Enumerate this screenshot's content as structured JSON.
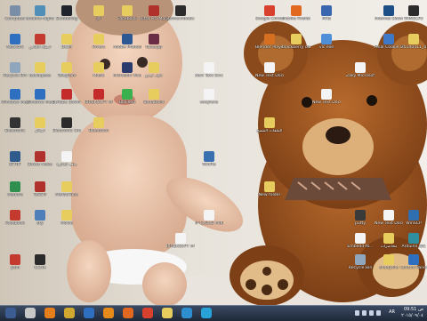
{
  "desktop": {
    "icons": [
      {
        "label": "Computer",
        "color": "#7a8ea8"
      },
      {
        "label": "arduino-nightly",
        "color": "#4f8fb8"
      },
      {
        "label": "Scrobbling",
        "color": "#20242c"
      },
      {
        "label": "jsi",
        "color": "#e6cd5e"
      },
      {
        "label": "Facebook",
        "color": "#e6cd5e"
      },
      {
        "label": "Ultra Pro Morph",
        "color": "#b0302c"
      },
      {
        "label": "itsmechdeels",
        "color": "#2c2c2c"
      },
      {
        "label": "Google Chrome",
        "color": "#d9412f"
      },
      {
        "label": "Mozilla Firefox",
        "color": "#e3681f"
      },
      {
        "label": "MHz",
        "color": "#3a66b0"
      },
      {
        "label": "Internet Download",
        "color": "#1c4f86"
      },
      {
        "label": "WINSCP5",
        "color": "#2c2c2c"
      },
      {
        "label": "Network",
        "color": "#2e6fc0"
      },
      {
        "label": "اسئلة الخاص",
        "color": "#c43a2f"
      },
      {
        "label": "DCIM",
        "color": "#e6cd5e"
      },
      {
        "label": "Rivers",
        "color": "#e6cd5e"
      },
      {
        "label": "Adobe Photoshop CS",
        "color": "#2b5893"
      },
      {
        "label": "faceapp",
        "color": "#6b2c45"
      },
      {
        "label": "Blender Player",
        "color": "#d66f1f"
      },
      {
        "label": "blackberry classic",
        "color": "#e6cd5e"
      },
      {
        "label": "vlc.exe",
        "color": "#4f8fd8"
      },
      {
        "label": "Final Cookie Player",
        "color": "#3e79c8"
      },
      {
        "label": "20140411_0",
        "color": "#e6cd5e"
      },
      {
        "label": "Recycle Bin",
        "color": "#8fa6bd"
      },
      {
        "label": "backupsse",
        "color": "#e6cd5e"
      },
      {
        "label": "Telegram",
        "color": "#e6cd5e"
      },
      {
        "label": "Music",
        "color": "#e6cd5e"
      },
      {
        "label": "Microsoft Visual Studio",
        "color": "#2a3a6c"
      },
      {
        "label": "دليل فيديو",
        "color": "#e6cd5e"
      },
      {
        "label": "New Text Document",
        "color": "#f4f4f4"
      },
      {
        "label": "New Text Document",
        "color": "#f4f4f4"
      },
      {
        "label": "Zaky Microsoft 2...",
        "color": "#f4f4f4"
      },
      {
        "label": "Windows Media Studio",
        "color": "#2e6fc0"
      },
      {
        "label": "Windows Media",
        "color": "#2e6fc0"
      },
      {
        "label": "ouTube Download",
        "color": "#c42b2b"
      },
      {
        "label": "BRISKSOFT MTECHNI",
        "color": "#c42b2b"
      },
      {
        "label": "BluFeed",
        "color": "#3ab04f"
      },
      {
        "label": "BanaBuild",
        "color": "#e6cd5e"
      },
      {
        "label": "saeyiexe",
        "color": "#f4f4f4"
      },
      {
        "label": "New Text Document",
        "color": "#f4f4f4"
      },
      {
        "label": "Electronic",
        "color": "#333333"
      },
      {
        "label": "اسلام",
        "color": "#e6cd5e"
      },
      {
        "label": "Electronic Circuits",
        "color": "#2b2b2b"
      },
      {
        "label": "Bluetooth",
        "color": "#e6cd5e"
      },
      {
        "label": "الملفات المسح",
        "color": "#e6cd5e"
      },
      {
        "label": "BFHIF",
        "color": "#2f5b8c"
      },
      {
        "label": "Boxxs Meka",
        "color": "#b0302c"
      },
      {
        "label": "ملف الدائرة",
        "color": "#f4f4f4"
      },
      {
        "label": "WinPls",
        "color": "#3a6fb0"
      },
      {
        "label": "Meditre",
        "color": "#2f8f4f"
      },
      {
        "label": "TeSSTr",
        "color": "#b0302c"
      },
      {
        "label": "MeYouTube",
        "color": "#e6cd5e"
      },
      {
        "label": "New folder",
        "color": "#e6cd5e"
      },
      {
        "label": "IP CLOUD MIKROTIK",
        "color": "#f4f4f4"
      },
      {
        "label": "putty",
        "color": "#3a3a3a"
      },
      {
        "label": "New Text Document",
        "color": "#f4f4f4"
      },
      {
        "label": "WinSCP",
        "color": "#2f6fb0"
      },
      {
        "label": "Facebook",
        "color": "#c43a2f"
      },
      {
        "label": "sky",
        "color": "#4f7fb8"
      },
      {
        "label": "Movie",
        "color": "#e6cd5e"
      },
      {
        "label": "BRISKSOFT MTECHNI",
        "color": "#f4f4f4"
      },
      {
        "label": "Embedd-Yo...",
        "color": "#f4f4f4"
      },
      {
        "label": "محاضرات",
        "color": "#e6cd5e"
      },
      {
        "label": "Arduino IDE",
        "color": "#2f8f9f"
      },
      {
        "label": "yam",
        "color": "#c43a2f"
      },
      {
        "label": "CCNA",
        "color": "#2b2b2b"
      },
      {
        "label": "Recycle Bin",
        "color": "#8fa6bd"
      },
      {
        "label": "shady.file",
        "color": "#e6cd5e"
      },
      {
        "label": "Control Panel",
        "color": "#2e6fc0"
      }
    ]
  },
  "taskbar": {
    "pinned": [
      {
        "name": "start",
        "color": "#3b5d91"
      },
      {
        "name": "pdf",
        "color": "#c8c8c8"
      },
      {
        "name": "vlc",
        "color": "#e67e1a"
      },
      {
        "name": "torch",
        "color": "#d1a830"
      },
      {
        "name": "ie",
        "color": "#2e6fc0"
      },
      {
        "name": "media-player",
        "color": "#e68a1a"
      },
      {
        "name": "firefox",
        "color": "#e3681f"
      },
      {
        "name": "chrome",
        "color": "#d9412f"
      },
      {
        "name": "folder",
        "color": "#e6cd5e"
      },
      {
        "name": "media",
        "color": "#2d8fd0"
      },
      {
        "name": "skype",
        "color": "#27a3d8"
      }
    ],
    "clock_time": "09:51 ص",
    "clock_date": "٢٠١٥/٠٩/٠٤",
    "lang": "AR"
  }
}
